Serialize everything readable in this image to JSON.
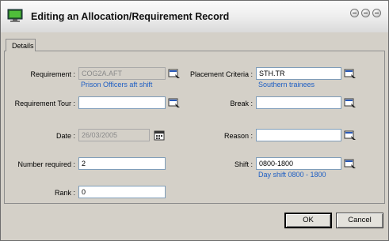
{
  "window": {
    "title": "Editing an Allocation/Requirement Record"
  },
  "tabs": [
    "Details"
  ],
  "form": {
    "requirement": {
      "label": "Requirement :",
      "value": "COG2A.AFT",
      "description": "Prison Officers aft shift"
    },
    "placement_criteria": {
      "label": "Placement Criteria :",
      "value": "STH.TR",
      "description": "Southern trainees"
    },
    "requirement_tour": {
      "label": "Requirement Tour :",
      "value": ""
    },
    "break": {
      "label": "Break :",
      "value": ""
    },
    "date": {
      "label": "Date :",
      "value": "26/03/2005"
    },
    "reason": {
      "label": "Reason :",
      "value": ""
    },
    "number_required": {
      "label": "Number required :",
      "value": "2"
    },
    "shift": {
      "label": "Shift :",
      "value": "0800-1800",
      "description": "Day shift 0800 - 1800"
    },
    "rank": {
      "label": "Rank :",
      "value": "0"
    }
  },
  "buttons": {
    "ok": "OK",
    "cancel": "Cancel"
  }
}
